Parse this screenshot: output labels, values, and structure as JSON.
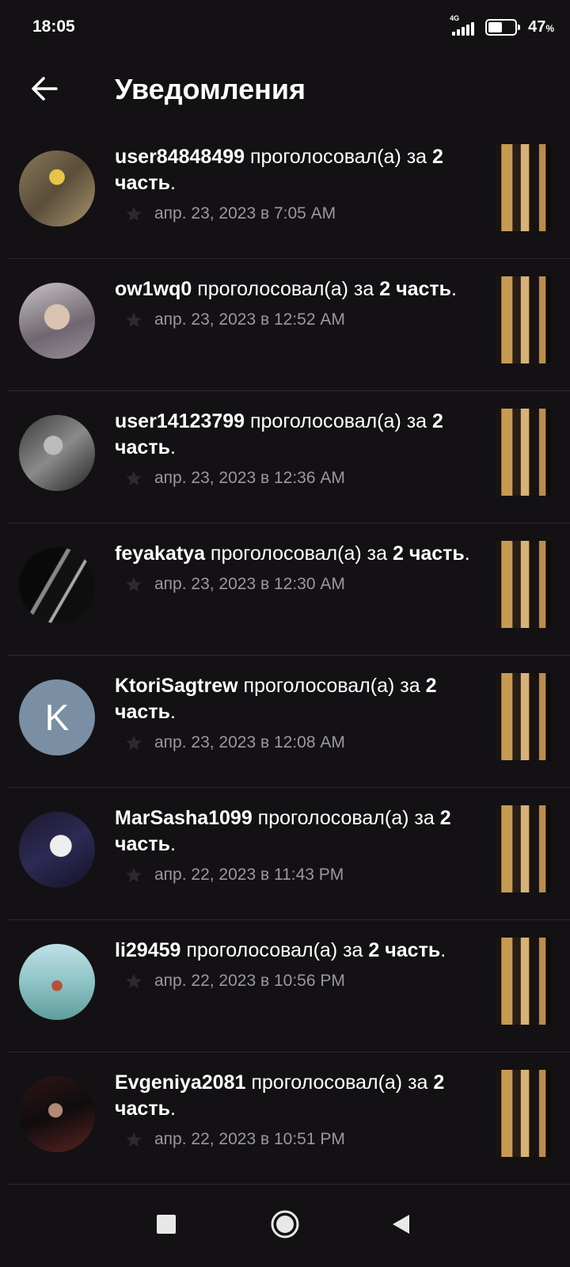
{
  "status_bar": {
    "time": "18:05",
    "network_type": "4G",
    "battery_percent": "47",
    "battery_unit": "%",
    "battery_level": 0.47
  },
  "header": {
    "title": "Уведомления",
    "back_icon": "arrow-left-icon"
  },
  "colors": {
    "background": "#131114",
    "text_primary": "#ffffff",
    "text_secondary": "#9a989c",
    "divider": "#2c2a2e",
    "avatar_letter_bg": "#7a8fa3"
  },
  "notifications": [
    {
      "username": "user84848499",
      "action": " проголосовал(а) за ",
      "part": "2 часть",
      "end": ".",
      "timestamp": "апр. 23, 2023 в 7:05 AM",
      "avatar_letter": ""
    },
    {
      "username": "ow1wq0",
      "action": " проголосовал(а) за ",
      "part": "2 часть",
      "end": ".",
      "timestamp": "апр. 23, 2023 в 12:52 AM",
      "avatar_letter": ""
    },
    {
      "username": "user14123799",
      "action": " проголосовал(а) за ",
      "part": "2 часть",
      "end": ".",
      "timestamp": "апр. 23, 2023 в 12:36 AM",
      "avatar_letter": ""
    },
    {
      "username": "feyakatya",
      "action": " проголосовал(а) за ",
      "part": "2 часть",
      "end": ".",
      "timestamp": "апр. 23, 2023 в 12:30 AM",
      "avatar_letter": ""
    },
    {
      "username": "KtoriSagtrew",
      "action": " проголосовал(а) за ",
      "part": "2 часть",
      "end": ".",
      "timestamp": "апр. 23, 2023 в 12:08 AM",
      "avatar_letter": "K"
    },
    {
      "username": "MarSasha1099",
      "action": " проголосовал(а) за ",
      "part": "2 часть",
      "end": ".",
      "timestamp": "апр. 22, 2023 в 11:43 PM",
      "avatar_letter": ""
    },
    {
      "username": "li29459",
      "action": " проголосовал(а) за ",
      "part": "2 часть",
      "end": ".",
      "timestamp": "апр. 22, 2023 в 10:56 PM",
      "avatar_letter": ""
    },
    {
      "username": "Evgeniya2081",
      "action": " проголосовал(а) за ",
      "part": "2 часть",
      "end": ".",
      "timestamp": "апр. 22, 2023 в 10:51 PM",
      "avatar_letter": ""
    }
  ],
  "nav_bar": {
    "recents_icon": "square-icon",
    "home_icon": "circle-icon",
    "back_icon": "triangle-back-icon"
  }
}
